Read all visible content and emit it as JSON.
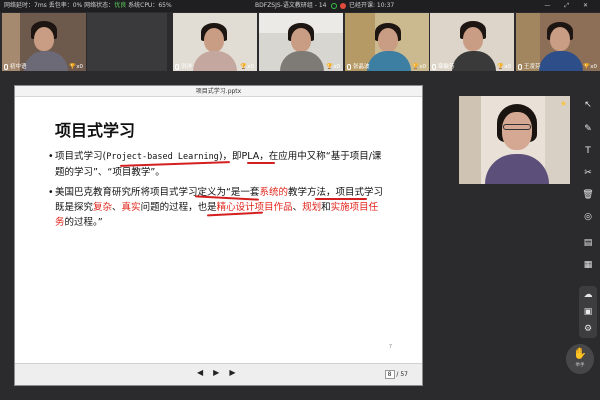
{
  "topbar": {
    "latency": "网络延时：7ms",
    "packet_loss": "丢包率：0%",
    "network_state_label": "网络状态：",
    "network_state_value": "优良",
    "cpu": "系统CPU：65%",
    "room_title": "BDFZSJS-语文教研组 - 14",
    "elapsed": "已经开课: 10:37",
    "window_controls": "— ⤢ ✕"
  },
  "participants": [
    {
      "name": "初中语",
      "trophy": "x0",
      "shirt": "#6d6a78"
    },
    {
      "name": "",
      "trophy": "",
      "shirt": "#5a5a5a"
    },
    {
      "name": "洪洋",
      "trophy": "x0",
      "shirt": "#c4a8a0"
    },
    {
      "name": "",
      "trophy": "x0",
      "shirt": "#d9d4c8"
    },
    {
      "name": "张晶波",
      "trophy": "x0",
      "shirt": "#3c7fa3"
    },
    {
      "name": "章敏芳",
      "trophy": "x0",
      "shirt": "#3a3a3a"
    },
    {
      "name": "王凌芬",
      "trophy": "x0",
      "shirt": "#2e4e8a"
    }
  ],
  "presentation": {
    "file_title": "项目式学习.pptx",
    "heading": "项目式学习",
    "bullet1": {
      "part1": "项目式学习(",
      "pbl": "Project-based Learning",
      "part2": ")，即",
      "pla": "PLA",
      "part3": "，在应用中又称“基于项目/课题的学习”、“项目教学”。"
    },
    "bullet2": {
      "t1": "美国巴克教育研究所将项目式学习定义为“是一套",
      "r1": "系统的",
      "t2": "教学方法，项目式学习既是探究",
      "r2": "复杂",
      "t3": "、",
      "r3": "真实",
      "t4": "问题的过程，也是",
      "r4": "精心设计项目作品",
      "t5": "、",
      "r5": "规划",
      "t6": "和",
      "r6": "实施项目任务",
      "t7": "的过程。”"
    },
    "slide_number": "7",
    "current_page": "8",
    "total_pages": "/ 57"
  },
  "toolbar_icons": [
    "mouse-pointer-icon",
    "pen-icon",
    "text-icon",
    "scissors-icon",
    "trash-icon",
    "record-icon",
    "document-icon",
    "image-icon",
    "cloud-icon",
    "toolbox-icon",
    "settings-icon"
  ],
  "hand_raise_label": "举手",
  "colors": {
    "accent_red": "#e0251b",
    "network_good": "#5fd35f",
    "trophy": "#f5c542"
  }
}
